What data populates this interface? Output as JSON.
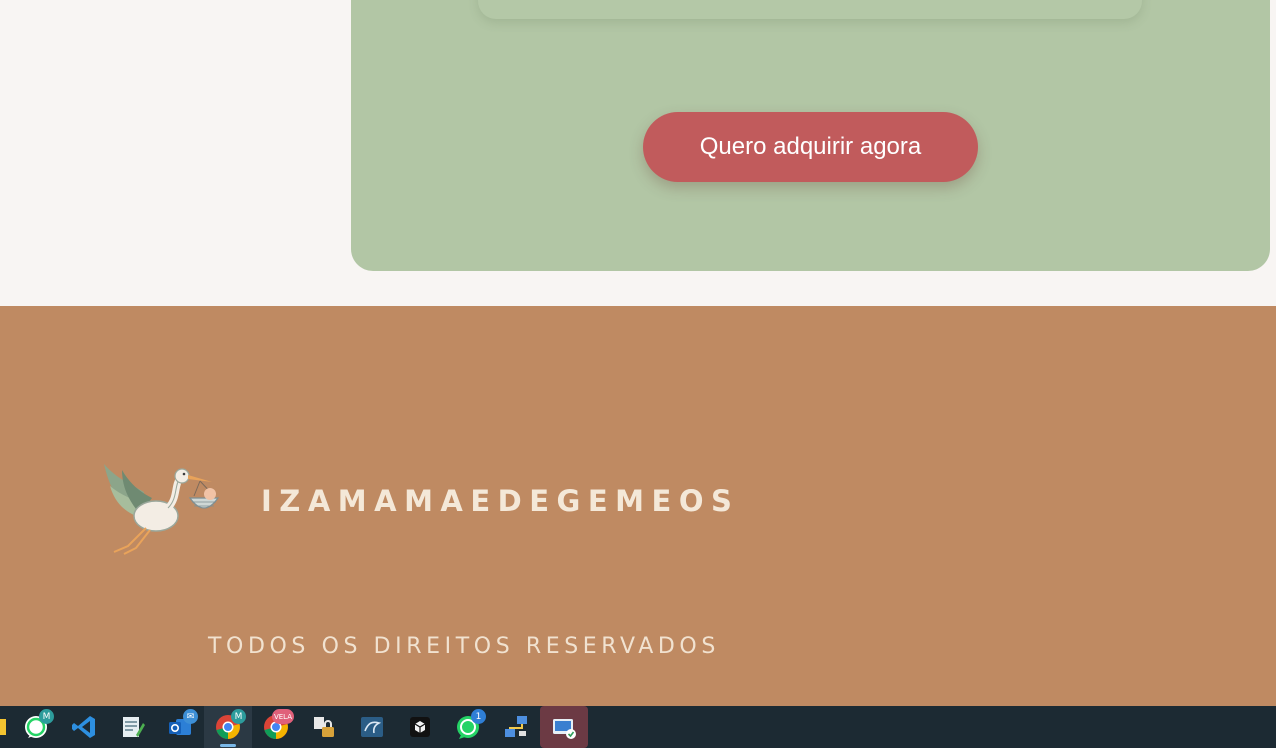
{
  "cta": {
    "label": "Quero adquirir agora",
    "color": "#c15b5c"
  },
  "section_color": "#b2c6a5",
  "footer": {
    "brand_name": "IZAMAMAEDEGEMEOS",
    "logo_icon": "stork-carrying-baby-icon",
    "copyright": "TODOS OS DIREITOS RESERVADOS",
    "background": "#bf8a62"
  },
  "taskbar": {
    "apps": [
      {
        "icon": "folder-icon"
      },
      {
        "icon": "whatsapp-business-icon",
        "badge": "M"
      },
      {
        "icon": "vscode-icon"
      },
      {
        "icon": "notepad-icon"
      },
      {
        "icon": "outlook-icon",
        "badge": "✉"
      },
      {
        "icon": "chrome-icon",
        "badge": "M",
        "state": "active"
      },
      {
        "icon": "chrome-profile-icon",
        "badge": "VELA"
      },
      {
        "icon": "security-lock-icon"
      },
      {
        "icon": "mysql-workbench-icon"
      },
      {
        "icon": "virtualbox-icon"
      },
      {
        "icon": "whatsapp-icon",
        "badge": "1"
      },
      {
        "icon": "network-icon"
      },
      {
        "icon": "remote-desktop-icon",
        "state": "selected"
      }
    ]
  }
}
